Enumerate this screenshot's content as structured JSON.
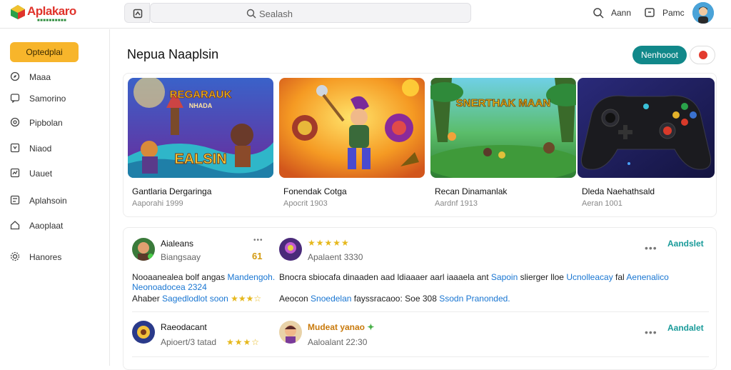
{
  "header": {
    "logo_text": "Aplakaro",
    "logo_tagline": "■■■■■■■■■■",
    "search_placeholder": "Sealash",
    "item1_label": "Aann",
    "item2_label": "Pamc"
  },
  "sidebar": {
    "primary_button": "Optedplai",
    "items": [
      {
        "label": "Maaa",
        "icon": "compass-icon"
      },
      {
        "label": "Samorino",
        "icon": "chat-icon"
      },
      {
        "label": "Pipbolan",
        "icon": "at-icon"
      },
      {
        "label": "Niaod",
        "icon": "screen-icon"
      },
      {
        "label": "Uauet",
        "icon": "chart-icon"
      },
      {
        "label": "Aplahsoin",
        "icon": "grid-icon"
      },
      {
        "label": "Aaoplaat",
        "icon": "home-icon"
      },
      {
        "label": "Hanores",
        "icon": "gear-icon"
      }
    ]
  },
  "main": {
    "title": "Nepua Naaplsin",
    "primary_button": "Nenhooot"
  },
  "cards": [
    {
      "title": "Gantlaria Dergaringa",
      "subtitle": "Aaporahi 1999",
      "art_title": "REGARAUK",
      "art_banner": "EALSIN",
      "art_small": "NHADA"
    },
    {
      "title": "Fonendak Cotga",
      "subtitle": "Apocrit 1903"
    },
    {
      "title": "Recan Dinamanlak",
      "subtitle": "Aardnf 1913",
      "art_title": "SNERTHAK MAAN"
    },
    {
      "title": "Dleda Naehathsald",
      "subtitle": "Aeran 1001"
    }
  ],
  "reviews": [
    {
      "col1_name": "Aialeans",
      "col1_sub": "Biangsaay",
      "col1_dots": "•••",
      "col1_num": "61",
      "col2_stars": "★★★★★",
      "col2_sub": "Apalaent 3330",
      "text_line1_a": "Nooaanealea bolf angas",
      "text_line1_b": "Mandengoh.",
      "text_line1_c": "Bnocra sbiocafa dinaaden aad ldiaaaer aarl iaaaela ant",
      "text_line1_d": "Sapoin",
      "text_line1_e": "slierger lloe",
      "text_line1_f": "Ucnolleacay",
      "text_line1_g": "fal",
      "text_line1_h": "Aenenalico",
      "text_line2": "Neonoadocea 2324",
      "text_line3_a": "Ahaber",
      "text_line3_b": "Sagedlodlot soon",
      "text_line3_stars": "★★★☆",
      "text_line3_c": "Aeocon",
      "text_line3_d": "Snoedelan",
      "text_line3_e": "fayssracaoo:",
      "text_line3_f": "Soe 308",
      "text_line3_g": "Ssodn Pranonded.",
      "more_dots": "•••",
      "action": "Aandslet"
    },
    {
      "col1_name": "Raeodacant",
      "col1_sub": "Apioert/3 tatad",
      "col1_stars": "★★★☆",
      "col2_name": "Mudeat yanao",
      "col2_sub": "Aaloalant 22:30",
      "more_dots": "•••",
      "action": "Aandalet"
    }
  ],
  "colors": {
    "accent_orange": "#f7b52b",
    "accent_teal": "#11888a",
    "logo_red": "#e0332b",
    "link_blue": "#1976d2",
    "action_teal": "#1a9b9a",
    "star_gold": "#e6b81d"
  }
}
